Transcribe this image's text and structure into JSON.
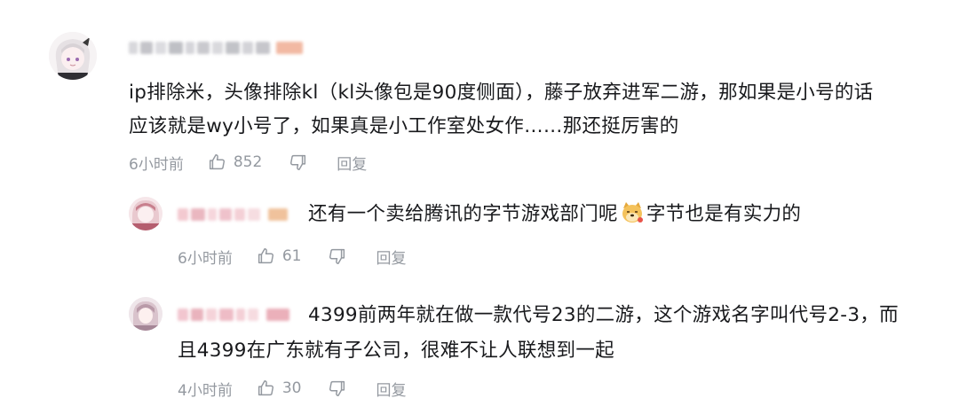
{
  "comments": [
    {
      "text_lines": [
        "ip排除米，头像排除kl（kl头像包是90度侧面），藤子放弃进军二游，那如果是小号的话",
        "应该就是wy小号了，如果真是小工作室处女作……那还挺厉害的"
      ],
      "time": "6小时前",
      "likes": "852",
      "reply_label": "回复"
    }
  ],
  "replies": [
    {
      "text_before_emoji": "还有一个卖给腾讯的字节游戏部门呢",
      "emoji_icon": "doge-emoji-icon",
      "text_after_emoji": "字节也是有实力的",
      "time": "6小时前",
      "likes": "61",
      "reply_label": "回复"
    },
    {
      "text_lines": [
        "4399前两年就在做一款代号23的二游，这个游戏名字叫代号2-3，而",
        "且4399在广东就有子公司，很难不让人联想到一起"
      ],
      "time": "4小时前",
      "likes": "30",
      "reply_label": "回复"
    }
  ],
  "colors": {
    "text": "#18191c",
    "meta": "#9499a0",
    "background": "#ffffff"
  }
}
